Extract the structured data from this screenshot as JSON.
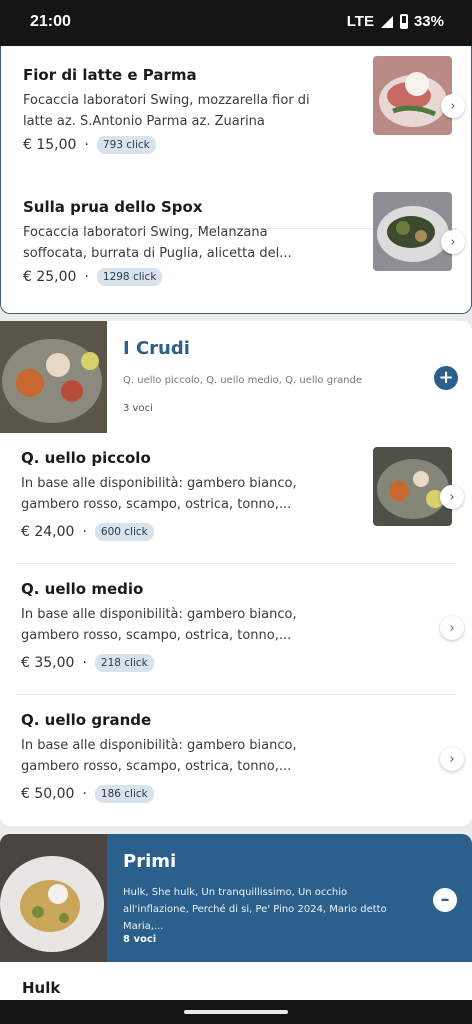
{
  "status": {
    "time": "21:00",
    "network": "LTE",
    "battery": "33%"
  },
  "top_items": [
    {
      "title": "Fior di latte e Parma",
      "desc": "Focaccia laboratori Swing, mozzarella fior di latte az. S.Antonio Parma az. Zuarina",
      "price": "€ 15,00",
      "clicks": "793 click",
      "image_icon": "food-photo"
    },
    {
      "title": "Sulla prua dello Spox",
      "desc": "Focaccia laboratori Swing, Melanzana soffocata, burrata di Puglia, alicetta del...",
      "price": "€ 25,00",
      "clicks": "1298 click",
      "image_icon": "food-photo"
    }
  ],
  "crudi": {
    "title": "I Crudi",
    "subtitle": "Q. uello piccolo, Q. uello medio, Q. uello grande",
    "count": "3 voci",
    "expand_icon": "plus-icon",
    "items": [
      {
        "title": "Q. uello piccolo",
        "desc": "In base alle disponibilità: gambero bianco, gambero rosso, scampo, ostrica, tonno,...",
        "price": "€ 24,00",
        "clicks": "600 click"
      },
      {
        "title": "Q. uello medio",
        "desc": "In base alle disponibilità: gambero bianco, gambero rosso, scampo, ostrica, tonno,...",
        "price": "€ 35,00",
        "clicks": "218 click"
      },
      {
        "title": "Q. uello grande",
        "desc": "In base alle disponibilità: gambero bianco, gambero rosso, scampo, ostrica, tonno,...",
        "price": "€ 50,00",
        "clicks": "186 click"
      }
    ]
  },
  "primi": {
    "title": "Primi",
    "subtitle": "Hulk, She hulk, Un tranquillissimo, Un occhio all'inflazione, Perché di si, Pe' Pino 2024, Mario detto Maria,...",
    "count": "8 voci",
    "collapse_icon": "minus-icon",
    "first_item": "Hulk"
  },
  "separator": "·",
  "chevron": "›",
  "colors": {
    "accent": "#2b5f8c",
    "badge_bg": "#d9e3ec",
    "border": "#3f5f86"
  }
}
